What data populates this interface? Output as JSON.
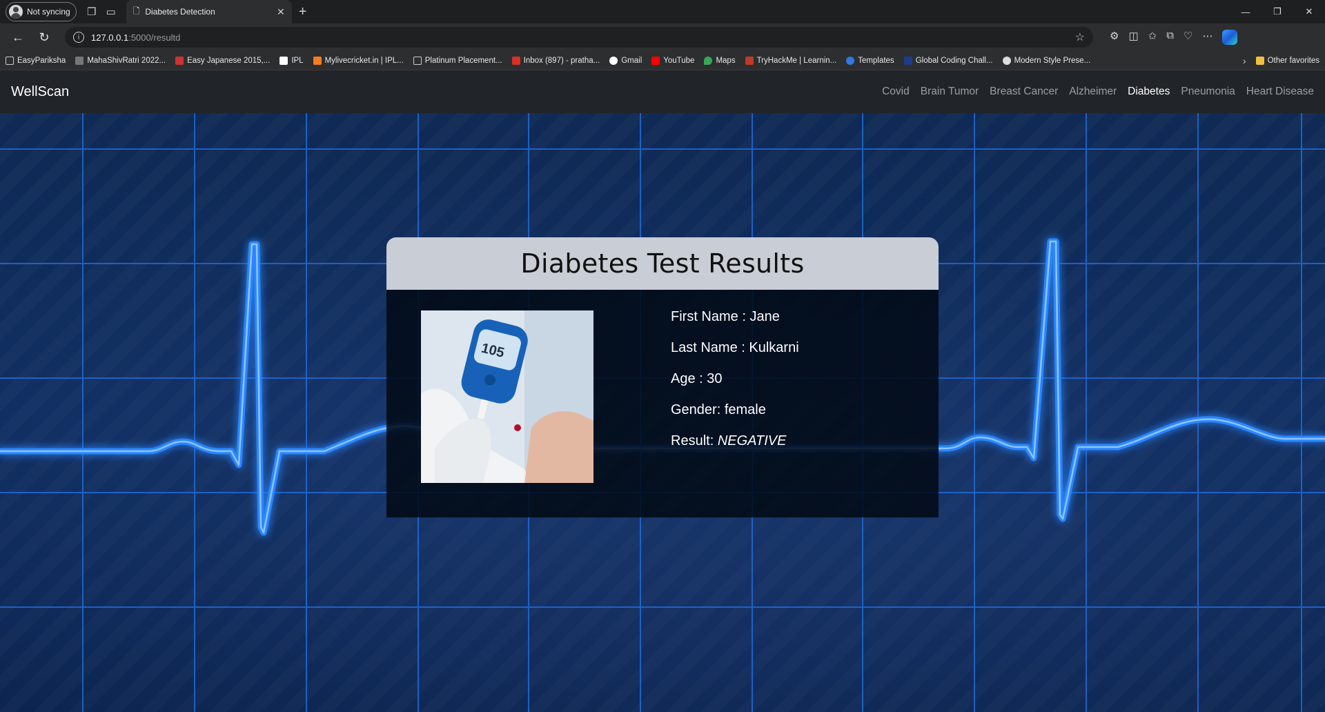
{
  "browser": {
    "profile_label": "Not syncing",
    "tab_title": "Diabetes Detection",
    "address_host": "127.0.0.1",
    "address_path": ":5000/resultd",
    "bookmarks": [
      "EasyPariksha",
      "MahaShivRatri 2022...",
      "Easy Japanese 2015,...",
      "IPL",
      "Mylivecricket.in | IPL...",
      "Platinum Placement...",
      "Inbox (897) - pratha...",
      "Gmail",
      "YouTube",
      "Maps",
      "TryHackMe | Learnin...",
      "Templates",
      "Global Coding Chall...",
      "Modern Style Prese..."
    ],
    "other_favorites": "Other favorites"
  },
  "nav": {
    "brand": "WellScan",
    "links": [
      "Covid",
      "Brain Tumor",
      "Breast Cancer",
      "Alzheimer",
      "Diabetes",
      "Pneumonia",
      "Heart Disease"
    ],
    "active": "Diabetes"
  },
  "result": {
    "title": "Diabetes Test Results",
    "first_name": "First Name : Jane",
    "last_name": "Last Name : Kulkarni",
    "age": "Age : 30",
    "gender": "Gender: female",
    "result_label": "Result: ",
    "result_value": "NEGATIVE",
    "meter_reading": "105"
  }
}
